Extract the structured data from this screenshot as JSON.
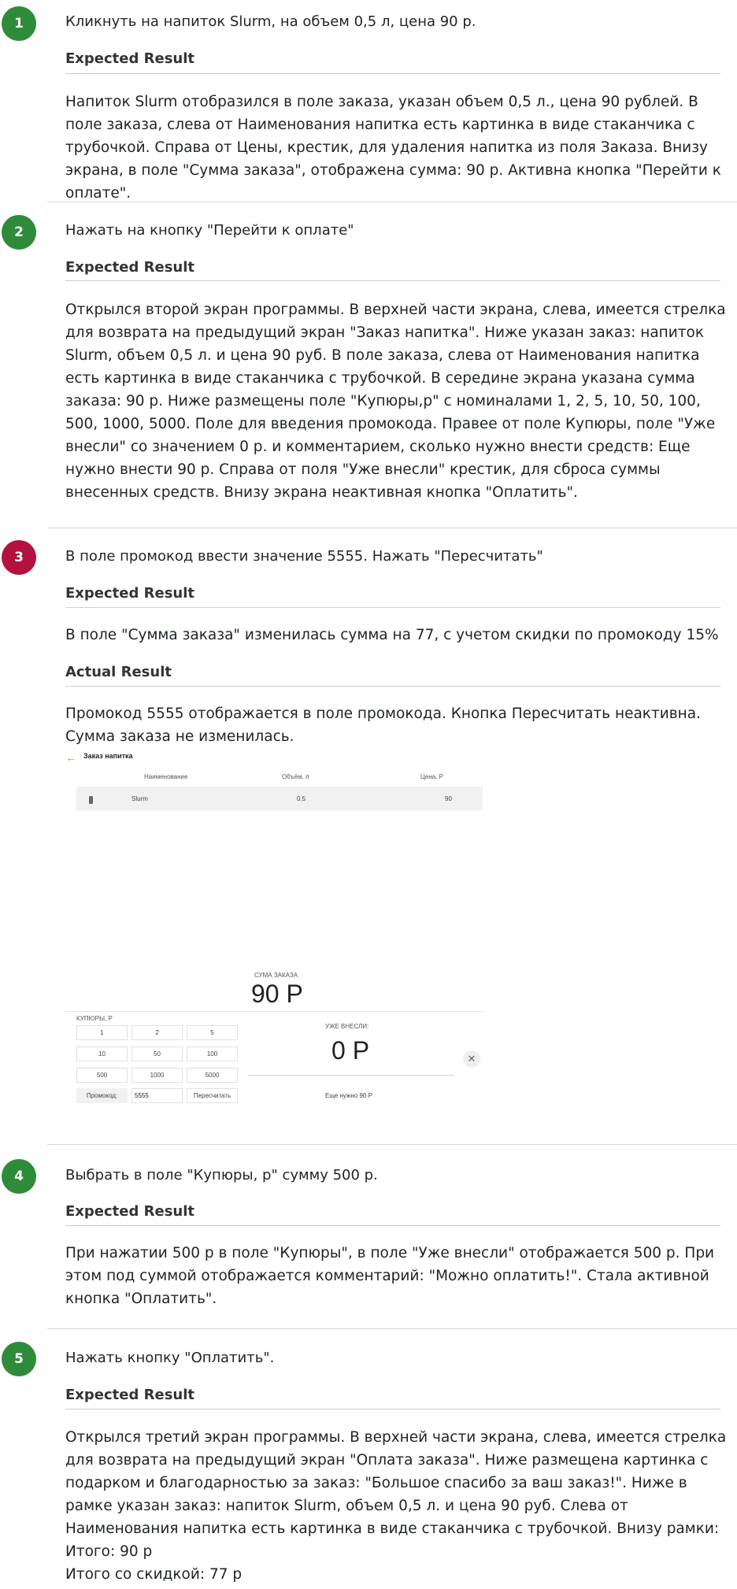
{
  "steps": [
    {
      "num": "1",
      "action": "Кликнуть на напиток Slurm, на объем 0,5 л, цена 90 р.",
      "expected_label": "Expected Result",
      "expected": "Напиток Slurm отобразился в поле заказа, указан объем 0,5 л., цена 90 рублей. В поле заказа, слева от Наименования напитка есть картинка в виде стаканчика с трубочкой. Справа от Цены, крестик, для удаления напитка из поля Заказа. Внизу экрана, в поле \"Сумма заказа\", отображена сумма: 90 р. Активна кнопка \"Перейти к оплате\"."
    },
    {
      "num": "2",
      "action": "Нажать на кнопку \"Перейти к оплате\"",
      "expected_label": "Expected Result",
      "expected": "Открылся второй экран программы. В верхней части экрана, слева, имеется стрелка для возврата на предыдущий экран \"Заказ напитка\". Ниже указан заказ: напиток Slurm, объем 0,5 л. и цена 90 руб. В поле заказа, слева от Наименования напитка есть картинка в виде стаканчика с трубочкой. В середине экрана указана сумма заказа: 90 р. Ниже размещены поле \"Купюры,р\" с номиналами 1, 2, 5, 10, 50, 100, 500, 1000, 5000. Поле для введения промокода. Правее от поле Купюры, поле \"Уже внесли\" со значением 0 р. и комментарием, сколько нужно внести средств: Еще нужно внести 90 р. Справа от поля \"Уже внесли\" крестик, для сброса суммы внесенных средств. Внизу экрана неактивная кнопка \"Оплатить\"."
    },
    {
      "num": "3",
      "action": "В поле промокод ввести значение 5555. Нажать \"Пересчитать\"",
      "expected_label": "Expected Result",
      "expected": "В поле \"Сумма заказа\" изменилась сумма на 77, с учетом скидки по промокоду 15%",
      "actual_label": "Actual Result",
      "actual": "Промокод 5555 отображается в поле промокода. Кнопка Пересчитать неактивна. Сумма заказа не изменилась."
    },
    {
      "num": "4",
      "action": "Выбрать в поле \"Купюры, р\" сумму 500 р.",
      "expected_label": "Expected Result",
      "expected": "При нажатии 500 р в поле \"Купюры\", в поле \"Уже внесли\" отображается 500 р. При этом под суммой отображается комментарий: \"Можно оплатить!\". Стала активной кнопка \"Оплатить\"."
    },
    {
      "num": "5",
      "action": "Нажать кнопку \"Оплатить\".",
      "expected_label": "Expected Result",
      "expected_lines": [
        "Открылся третий экран программы. В верхней части экрана, слева, имеется стрелка для возврата на предыдущий экран \"Оплата заказа\". Ниже размещена картинка с подарком и благодарностью за заказ: \"Большое спасибо за ваш заказ!\". Ниже в рамке указан заказ: напиток Slurm, объем 0,5 л. и цена 90 руб. Слева от Наименования напитка есть картинка в виде стаканчика с трубочкой. Внизу рамки:",
        "Итого: 90 р",
        "Итого со скидкой: 77 р"
      ]
    }
  ],
  "app": {
    "title": "Заказ напитка",
    "col_name": "Наименование",
    "col_volume": "Объём, л",
    "col_price": "Цена, Р",
    "item_name": "Slurm",
    "item_volume": "0.5",
    "item_price": "90",
    "sum_label": "СУМА ЗАКАЗА",
    "sum_value": "90 Р",
    "bills_label": "КУПЮРЫ, Р",
    "bills": [
      "1",
      "2",
      "5",
      "10",
      "50",
      "100",
      "500",
      "1000",
      "5000"
    ],
    "promo_label": "Промокод:",
    "promo_value": "5555",
    "recalc_label": "Пересчитать",
    "paid_label": "УЖЕ ВНЕСЛИ:",
    "paid_value": "0 Р",
    "need_text": "Еще нужно 90 Р",
    "icons": {
      "back": "arrow-left-icon",
      "cup": "cup-icon",
      "reset": "close-icon"
    },
    "accent_color": "#7ab51d"
  },
  "colors": {
    "step_green": "#2e8b3a",
    "step_red": "#b3123f"
  }
}
